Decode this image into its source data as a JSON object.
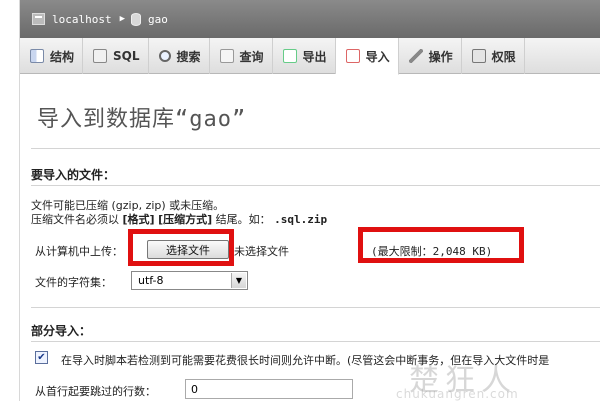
{
  "breadcrumb": {
    "server": "localhost",
    "database": "gao"
  },
  "tabs": [
    {
      "label": "结构",
      "icon": "structure-icon"
    },
    {
      "label": "SQL",
      "icon": "sql-icon"
    },
    {
      "label": "搜索",
      "icon": "search-icon"
    },
    {
      "label": "查询",
      "icon": "query-icon"
    },
    {
      "label": "导出",
      "icon": "export-icon"
    },
    {
      "label": "导入",
      "icon": "import-icon",
      "active": true
    },
    {
      "label": "操作",
      "icon": "wrench-icon"
    },
    {
      "label": "权限",
      "icon": "privileges-icon"
    }
  ],
  "page": {
    "title": "导入到数据库“gao”"
  },
  "file_section": {
    "heading": "要导入的文件：",
    "compress_note": "文件可能已压缩 (gzip, zip) 或未压缩。",
    "name_note_prefix": "压缩文件名必须以",
    "name_note_format": "[格式]",
    "name_note_compression": "[压缩方式]",
    "name_note_suffix": "结尾。如：",
    "name_note_example": ".sql.zip",
    "upload_label": "从计算机中上传：",
    "choose_button": "选择文件",
    "no_file_text": "未选择文件",
    "max_limit": "(最大限制：2,048 KB)",
    "charset_label": "文件的字符集：",
    "charset_value": "utf-8"
  },
  "partial_section": {
    "heading": "部分导入：",
    "allow_interrupt": "在导入时脚本若检测到可能需要花费很长时间则允许中断。(尽管这会中断事务，但在导入大文件时是",
    "allow_interrupt_checked": true,
    "skip_rows_label": "从首行起要跳过的行数：",
    "skip_rows_value": "0"
  },
  "watermark": {
    "text": "楚狂人",
    "url": "chukuangren.com"
  },
  "colors": {
    "highlight": "#e01010",
    "crumb_bar": "#777777"
  }
}
